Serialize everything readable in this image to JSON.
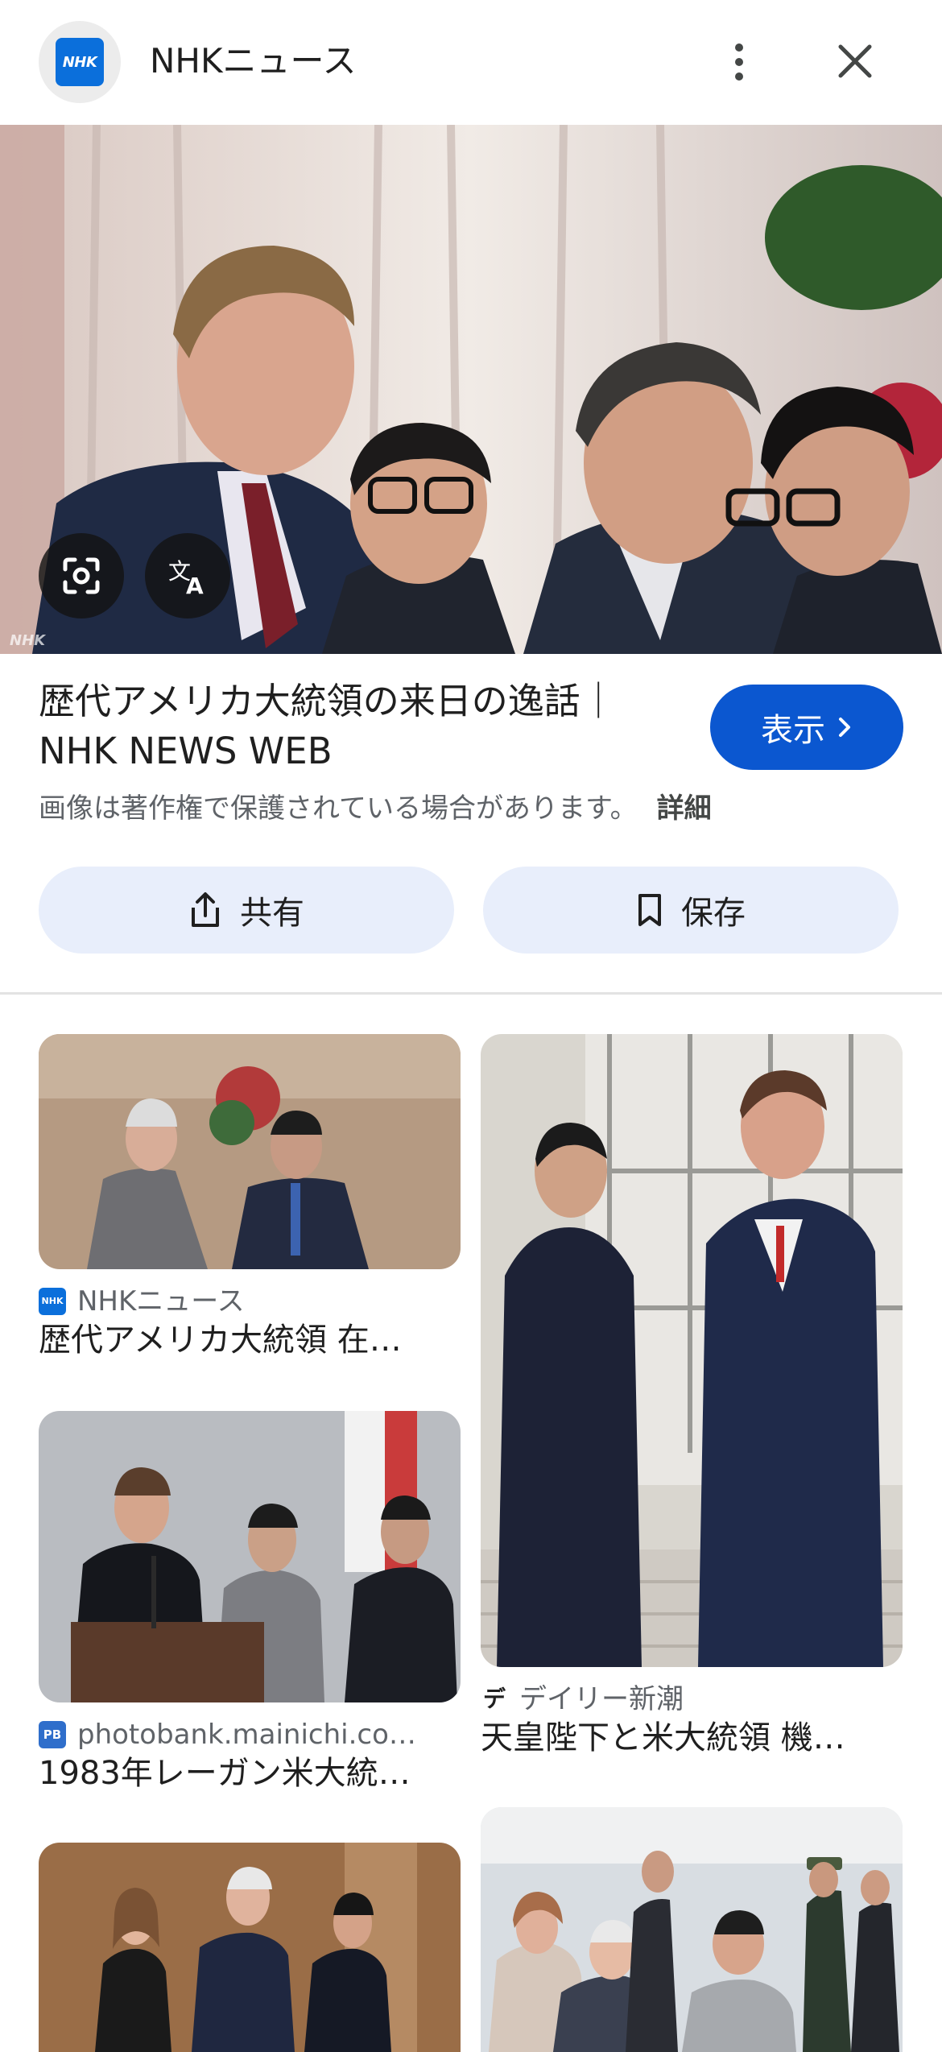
{
  "header": {
    "site_name": "NHKニュース",
    "logo_text": "NHK",
    "icons": [
      "more-vert-icon",
      "close-icon"
    ]
  },
  "main": {
    "watermark": "NHK",
    "title_line1": "歴代アメリカ大統領の来日の逸話｜",
    "title_line2": "NHK NEWS WEB",
    "view_label": "表示",
    "copyright_text": "画像は著作権で保護されている場合があります。",
    "details_label": "詳細",
    "share_label": "共有",
    "save_label": "保存"
  },
  "results": [
    {
      "source": "NHKニュース",
      "source_icon_text": "NHK",
      "caption": "歴代アメリカ大統領 在…"
    },
    {
      "source": "デイリー新潮",
      "source_icon_text": "デ",
      "caption": "天皇陛下と米大統領 機…"
    },
    {
      "source": "photobank.mainichi.co…",
      "source_icon_text": "PB",
      "caption": "1983年レーガン米大統…"
    },
    {
      "source": "",
      "source_icon_text": "",
      "caption": ""
    },
    {
      "source": "",
      "source_icon_text": "",
      "caption": ""
    }
  ],
  "colors": {
    "accent": "#0b57d0",
    "action_bg": "#e8eefb",
    "nhk_blue": "#0b6fdb"
  }
}
